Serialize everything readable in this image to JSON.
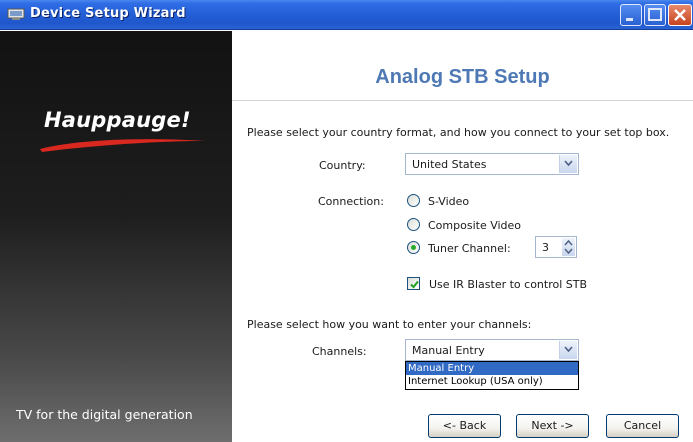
{
  "window": {
    "title": "Device Setup Wizard"
  },
  "sidebar": {
    "brand": "Hauppauge!",
    "tagline": "TV for the digital generation"
  },
  "main": {
    "heading": "Analog STB Setup",
    "intro": "Please select your country format, and how you connect to your set top box.",
    "country_label": "Country:",
    "country_value": "United States",
    "connection_label": "Connection:",
    "connection_options": [
      {
        "label": "S-Video",
        "selected": false
      },
      {
        "label": "Composite Video",
        "selected": false
      },
      {
        "label": "Tuner Channel:",
        "selected": true
      }
    ],
    "tuner_channel_value": "3",
    "ir_blaster_label": "Use IR Blaster to control STB",
    "ir_blaster_checked": true,
    "channels_prompt": "Please select how you want to enter your channels:",
    "channels_label": "Channels:",
    "channels_value": "Manual Entry",
    "channels_options": [
      "Manual Entry",
      "Internet Lookup (USA only)"
    ]
  },
  "footer": {
    "back_label": "<- Back",
    "next_label": "Next ->",
    "cancel_label": "Cancel"
  },
  "colors": {
    "titlebar": "#2560d8",
    "heading": "#4e79b4",
    "selection": "#316ac5",
    "radio_dot": "#2aaa2a"
  }
}
